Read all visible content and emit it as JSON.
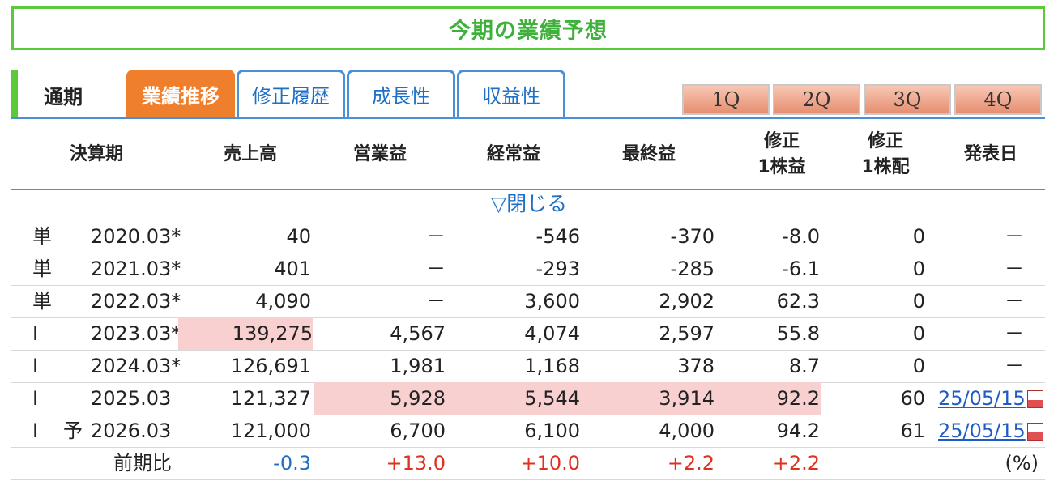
{
  "title": "今期の業績予想",
  "period_label": "通期",
  "tabs": [
    {
      "label": "業績推移",
      "active": true
    },
    {
      "label": "修正履歴",
      "active": false
    },
    {
      "label": "成長性",
      "active": false
    },
    {
      "label": "収益性",
      "active": false
    }
  ],
  "quarters": [
    "1Q",
    "2Q",
    "3Q",
    "4Q"
  ],
  "columns": {
    "period": "決算期",
    "sales": "売上高",
    "op": "営業益",
    "ordinary": "経常益",
    "net": "最終益",
    "eps_l1": "修正",
    "eps_l2": "1株益",
    "div_l1": "修正",
    "div_l2": "1株配",
    "date": "発表日"
  },
  "toggle_label": "▽閉じる",
  "rows": [
    {
      "kind": "単",
      "mark": "",
      "period": "2020.03*",
      "sales": "40",
      "op": "－",
      "ordinary": "-546",
      "net": "-370",
      "eps": "-8.0",
      "div": "0",
      "date": "－"
    },
    {
      "kind": "単",
      "mark": "",
      "period": "2021.03*",
      "sales": "401",
      "op": "－",
      "ordinary": "-293",
      "net": "-285",
      "eps": "-6.1",
      "div": "0",
      "date": "－"
    },
    {
      "kind": "単",
      "mark": "",
      "period": "2022.03*",
      "sales": "4,090",
      "op": "－",
      "ordinary": "3,600",
      "net": "2,902",
      "eps": "62.3",
      "div": "0",
      "date": "－"
    },
    {
      "kind": "I",
      "mark": "",
      "period": "2023.03*",
      "sales": "139,275",
      "op": "4,567",
      "ordinary": "4,074",
      "net": "2,597",
      "eps": "55.8",
      "div": "0",
      "date": "－"
    },
    {
      "kind": "I",
      "mark": "",
      "period": "2024.03*",
      "sales": "126,691",
      "op": "1,981",
      "ordinary": "1,168",
      "net": "378",
      "eps": "8.7",
      "div": "0",
      "date": "－"
    },
    {
      "kind": "I",
      "mark": "",
      "period": "2025.03",
      "sales": "121,327",
      "op": "5,928",
      "ordinary": "5,544",
      "net": "3,914",
      "eps": "92.2",
      "div": "60",
      "date": "25/05/15"
    },
    {
      "kind": "I",
      "mark": "予",
      "period": "2026.03",
      "sales": "121,000",
      "op": "6,700",
      "ordinary": "6,100",
      "net": "4,000",
      "eps": "94.2",
      "div": "61",
      "date": "25/05/15"
    }
  ],
  "yoy": {
    "label": "前期比",
    "sales": "-0.3",
    "op": "+13.0",
    "ordinary": "+10.0",
    "net": "+2.2",
    "eps": "+2.2",
    "unit": "(%)"
  },
  "colors": {
    "green": "#5cc83c",
    "active_tab": "#ef7f2d",
    "blue": "#1f6fc4",
    "highlight": "#f8d0d0",
    "up": "#e0301e",
    "down": "#1f6fc4"
  }
}
